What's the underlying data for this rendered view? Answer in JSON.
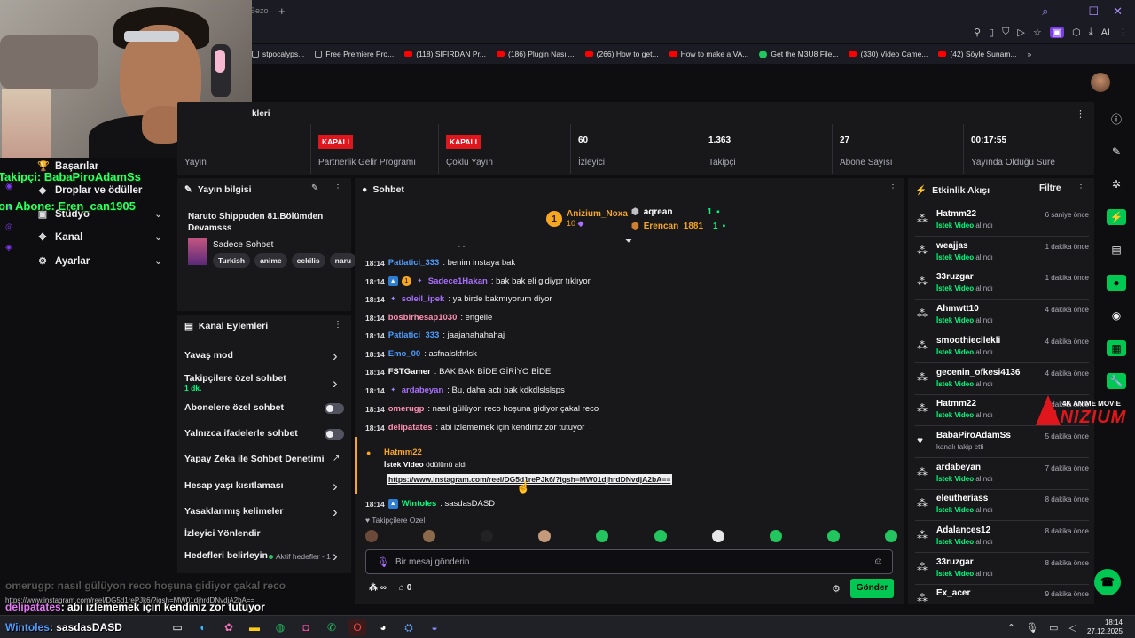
{
  "browser": {
    "tab_text": "Sezo",
    "new_tab": "+",
    "bookmarks": [
      {
        "label": "stpocalyps...",
        "icon": "gy"
      },
      {
        "label": "Free Premiere Pro...",
        "icon": "gy"
      },
      {
        "label": "(118) SIFIRDAN Pr...",
        "icon": "yt"
      },
      {
        "label": "(186) Plugin Nasıl...",
        "icon": "yt"
      },
      {
        "label": "(266) How to get...",
        "icon": "yt"
      },
      {
        "label": "How to make a VA...",
        "icon": "yt"
      },
      {
        "label": "Get the M3U8 File...",
        "icon": "gr"
      },
      {
        "label": "(330) Video Came...",
        "icon": "yt"
      },
      {
        "label": "(42) Söyle Sunam...",
        "icon": "yt"
      },
      {
        "label": "»",
        "icon": "none"
      }
    ]
  },
  "overlay": {
    "follower_line": "Takipçi: BabaPiroAdamSs",
    "subscriber_line": "on Abone: Eren_can1905",
    "chat_line_1_user": "omerugp",
    "chat_line_1_text": ": nasıl gülüyon reco hoşuna gidiyor çakal reco",
    "chat_line_2_user": "delipatates",
    "chat_line_2_text": ": abi izlememek için kendiniz zor tutuyor",
    "chat_line_3_user": "Wintoles",
    "chat_line_3_text": ": sasdasDASD",
    "url_text": "https://www.instagram.com/reel/DG5d1rePJk6/?igsh=MW01djhrdDNvdjA2bA=="
  },
  "sidebar": {
    "items": [
      {
        "label": "Başarılar",
        "icon": "trophy-icon"
      },
      {
        "label": "Droplar ve ödüller",
        "icon": "gift-icon"
      },
      {
        "label": "Stüdyo",
        "icon": "studio-icon"
      },
      {
        "label": "Kanal",
        "icon": "channel-icon"
      },
      {
        "label": "Ayarlar",
        "icon": "gear-icon"
      }
    ]
  },
  "stats": {
    "title": "kleri",
    "items": [
      {
        "value": "",
        "label": "Yayın",
        "badge": ""
      },
      {
        "value": "",
        "label": "Partnerlik Gelir Programı",
        "badge": "KAPALI"
      },
      {
        "value": "",
        "label": "Çoklu Yayın",
        "badge": "KAPALI"
      },
      {
        "value": "60",
        "label": "İzleyici",
        "badge": ""
      },
      {
        "value": "1.363",
        "label": "Takipçi",
        "badge": ""
      },
      {
        "value": "27",
        "label": "Abone Sayısı",
        "badge": ""
      },
      {
        "value": "00:17:55",
        "label": "Yayında Olduğu Süre",
        "badge": ""
      }
    ]
  },
  "stream_info": {
    "header": "Yayın bilgisi",
    "title": "Naruto Shippuden 81.Bölümden Devamsss",
    "category": "Sadece Sohbet",
    "tags": [
      "Turkish",
      "anime",
      "cekilis",
      "naru"
    ]
  },
  "channel_actions": {
    "header": "Kanal Eylemleri",
    "items": [
      {
        "label": "Yavaş mod",
        "sub": "",
        "control": "chevron"
      },
      {
        "label": "Takipçilere özel sohbet",
        "sub": "1 dk.",
        "control": "chevron"
      },
      {
        "label": "Abonelere özel sohbet",
        "sub": "",
        "control": "toggle"
      },
      {
        "label": "Yalnızca ifadelerle sohbet",
        "sub": "",
        "control": "toggle"
      },
      {
        "label": "Yapay Zeka ile Sohbet Denetimi",
        "sub": "",
        "control": "external"
      },
      {
        "label": "Hesap yaşı kısıtlaması",
        "sub": "",
        "control": "chevron"
      },
      {
        "label": "Yasaklanmış kelimeler",
        "sub": "",
        "control": "chevron"
      },
      {
        "label": "İzleyici Yönlendir",
        "sub": "",
        "control": "none"
      },
      {
        "label": "Hedefleri belirleyin",
        "sub": "",
        "control": "chevron"
      }
    ],
    "active_goals": "Aktif hedefler - 1"
  },
  "chat": {
    "header": "Sohbet",
    "leaders": [
      {
        "rank": "1",
        "name": "Anizium_Noxa",
        "count": "10"
      },
      {
        "name": "aqrean",
        "count": "1"
      },
      {
        "name": "Erencan_1881",
        "count": "1"
      }
    ],
    "messages": [
      {
        "time": "18:14",
        "user": "Patlatici_333",
        "color": "#4f9cff",
        "text": ": benim instaya bak",
        "badges": []
      },
      {
        "time": "18:14",
        "user": "Sadece1Hakan",
        "color": "#a970ff",
        "text": ": bak bak eli gidiypr tıklıyor",
        "badges": [
          "blue",
          "gold",
          "purp"
        ]
      },
      {
        "time": "18:14",
        "user": "soleil_ipek",
        "color": "#a970ff",
        "text": ": ya birde bakmıyorum diyor",
        "badges": [
          "purp"
        ]
      },
      {
        "time": "18:14",
        "user": "bosbirhesap1030",
        "color": "#ff8fb1",
        "text": ": engelle",
        "badges": []
      },
      {
        "time": "18:14",
        "user": "Patlatici_333",
        "color": "#4f9cff",
        "text": ": jaajahahahahaj",
        "badges": []
      },
      {
        "time": "18:14",
        "user": "Emo_00",
        "color": "#4f9cff",
        "text": ": asfnalskfnlsk",
        "badges": []
      },
      {
        "time": "18:14",
        "user": "FSTGamer",
        "color": "#ffffff",
        "text": ": BAK BAK BİDE GİRİYO BİDE",
        "badges": []
      },
      {
        "time": "18:14",
        "user": "ardabeyan",
        "color": "#a970ff",
        "text": ": Bu, daha actı bak kdkdlslslsps",
        "badges": [
          "purp"
        ]
      },
      {
        "time": "18:14",
        "user": "omerugp",
        "color": "#ff8fb1",
        "text": ": nasıl gülüyon reco hoşuna gidiyor çakal reco",
        "badges": []
      },
      {
        "time": "18:14",
        "user": "delipatates",
        "color": "#ff8fb1",
        "text": ": abi izlememek için kendiniz zor tutuyor",
        "badges": []
      }
    ],
    "highlight": {
      "user": "Hatmm22",
      "reward": "İstek Video",
      "reward_suffix": " ödülünü aldı",
      "link": "https://www.instagram.com/reel/DG5d1rePJk6/?igsh=MW01djhrdDNvdjA2bA=="
    },
    "last_message": {
      "time": "18:14",
      "user": "Wintoles",
      "color": "#00ff7f",
      "text": ": sasdasDASD"
    },
    "followers_only_label": "Takipçilere Özel",
    "input_placeholder": "Bir mesaj gönderin",
    "points": "∞",
    "store_count": "0",
    "send_label": "Gönder"
  },
  "activity": {
    "header": "Etkinlik Akışı",
    "filter_label": "Filtre",
    "items": [
      {
        "name": "Hatmm22",
        "reward": "İstek Video",
        "desc": " alındı",
        "time": "6 saniye önce",
        "icon": "reward"
      },
      {
        "name": "weajjas",
        "reward": "İstek Video",
        "desc": " alındı",
        "time": "1 dakika önce",
        "icon": "reward"
      },
      {
        "name": "33ruzgar",
        "reward": "İstek Video",
        "desc": " alındı",
        "time": "1 dakika önce",
        "icon": "reward"
      },
      {
        "name": "Ahmwtt10",
        "reward": "İstek Video",
        "desc": " alındı",
        "time": "4 dakika önce",
        "icon": "reward"
      },
      {
        "name": "smoothiecilekli",
        "reward": "İstek Video",
        "desc": " alındı",
        "time": "4 dakika önce",
        "icon": "reward"
      },
      {
        "name": "gecenin_ofkesi4136",
        "reward": "İstek Video",
        "desc": " alındı",
        "time": "4 dakika önce",
        "icon": "reward"
      },
      {
        "name": "Hatmm22",
        "reward": "İstek Video",
        "desc": " alındı",
        "time": "4 dakika önce",
        "icon": "reward"
      },
      {
        "name": "BabaPiroAdamSs",
        "reward": "",
        "desc": "kanalı takip etti",
        "time": "5 dakika önce",
        "icon": "heart"
      },
      {
        "name": "ardabeyan",
        "reward": "İstek Video",
        "desc": " alındı",
        "time": "7 dakika önce",
        "icon": "reward"
      },
      {
        "name": "eleutheriass",
        "reward": "İstek Video",
        "desc": " alındı",
        "time": "8 dakika önce",
        "icon": "reward"
      },
      {
        "name": "Adalances12",
        "reward": "İstek Video",
        "desc": " alındı",
        "time": "8 dakika önce",
        "icon": "reward"
      },
      {
        "name": "33ruzgar",
        "reward": "İstek Video",
        "desc": " alındı",
        "time": "8 dakika önce",
        "icon": "reward"
      },
      {
        "name": "Ex_acer",
        "reward": "",
        "desc": "",
        "time": "9 dakika önce",
        "icon": "reward"
      }
    ]
  },
  "logo": {
    "small": "4K ANIME MOVIE",
    "big": "ANIZIUM"
  },
  "taskbar": {
    "time": "18:14",
    "date": "27.12.2025"
  },
  "colors": {
    "accent": "#00c853",
    "live_red": "#e0161d",
    "reward_gold": "#f5a623",
    "purple": "#a970ff"
  }
}
